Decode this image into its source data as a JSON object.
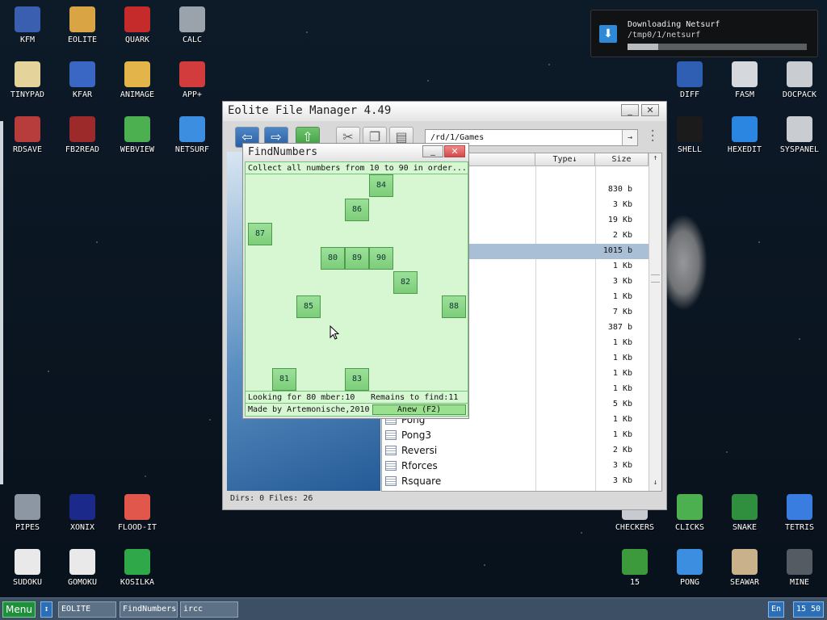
{
  "desktop_icons": [
    {
      "label": "KFM",
      "icon": "floppy-icon",
      "color": "#3b5fb0"
    },
    {
      "label": "EOLITE",
      "icon": "folder-icon",
      "color": "#d9a544"
    },
    {
      "label": "QUARK",
      "icon": "notebook-icon",
      "color": "#c62b2b"
    },
    {
      "label": "CALC",
      "icon": "calculator-icon",
      "color": "#9aa2ab"
    },
    {
      "label": "TINYPAD",
      "icon": "notepad-icon",
      "color": "#e4d39a"
    },
    {
      "label": "KFAR",
      "icon": "archive-icon",
      "color": "#3a66c4"
    },
    {
      "label": "ANIMAGE",
      "icon": "brush-icon",
      "color": "#e3b44a"
    },
    {
      "label": "APP+",
      "icon": "cube-icon",
      "color": "#d23c3c"
    },
    {
      "label": "RDSAVE",
      "icon": "disk-save-icon",
      "color": "#b73c3c"
    },
    {
      "label": "FB2READ",
      "icon": "book-icon",
      "color": "#9c2a2a"
    },
    {
      "label": "WEBVIEW",
      "icon": "webpage-icon",
      "color": "#4caf50"
    },
    {
      "label": "NETSURF",
      "icon": "globe-icon",
      "color": "#3b8ee0"
    },
    {
      "label": "DIFF",
      "icon": "compare-icon",
      "color": "#2e5fb3"
    },
    {
      "label": "FASM",
      "icon": "chip-icon",
      "color": "#d5d8dc"
    },
    {
      "label": "DOCPACK",
      "icon": "cabinet-icon",
      "color": "#c9cdd2"
    },
    {
      "label": "SHELL",
      "icon": "terminal-icon",
      "color": "#1b1b1b"
    },
    {
      "label": "HEXEDIT",
      "icon": "hex-icon",
      "color": "#2a86e0"
    },
    {
      "label": "SYSPANEL",
      "icon": "sliders-icon",
      "color": "#c9cdd2"
    },
    {
      "label": "PIPES",
      "icon": "pipes-icon",
      "color": "#8d97a3"
    },
    {
      "label": "XONIX",
      "icon": "xonix-icon",
      "color": "#1b2a8a"
    },
    {
      "label": "FLOOD-IT",
      "icon": "color-grid-icon",
      "color": "#e2574c"
    },
    {
      "label": "SUDOKU",
      "icon": "sudoku-icon",
      "color": "#e9e9e9"
    },
    {
      "label": "GOMOKU",
      "icon": "tictactoe-icon",
      "color": "#e9e9e9"
    },
    {
      "label": "KOSILKA",
      "icon": "lawnmower-icon",
      "color": "#2fa84a"
    },
    {
      "label": "CHECKERS",
      "icon": "checkers-icon",
      "color": "#c7cbd0"
    },
    {
      "label": "CLICKS",
      "icon": "blocks-icon",
      "color": "#4caf50"
    },
    {
      "label": "SNAKE",
      "icon": "snake-icon",
      "color": "#2f8f3f"
    },
    {
      "label": "TETRIS",
      "icon": "tetris-icon",
      "color": "#3a7de0"
    },
    {
      "label": "15",
      "icon": "fifteen-puzzle-icon",
      "color": "#3c9a3c"
    },
    {
      "label": "PONG",
      "icon": "pong-icon",
      "color": "#3b8ee0"
    },
    {
      "label": "SEAWAR",
      "icon": "ship-icon",
      "color": "#c9b18b"
    },
    {
      "label": "MINE",
      "icon": "mine-icon",
      "color": "#555b62"
    }
  ],
  "notification": {
    "title": "Downloading Netsurf",
    "path": "/tmp0/1/netsurf",
    "progress": 0.17
  },
  "eolite": {
    "title": "Eolite File Manager 4.49",
    "path": "/rd/1/Games",
    "columns": {
      "type": "Type↓",
      "size": "Size"
    },
    "rows": [
      {
        "name": "",
        "size": "830 b"
      },
      {
        "name": "",
        "size": "3 Kb"
      },
      {
        "name": "",
        "size": "19 Kb"
      },
      {
        "name": "",
        "size": "2 Kb"
      },
      {
        "name": "",
        "size": "1015 b",
        "selected": true
      },
      {
        "name": "",
        "size": "1 Kb"
      },
      {
        "name": "",
        "size": "3 Kb"
      },
      {
        "name": "",
        "size": "1 Kb"
      },
      {
        "name": "",
        "size": "7 Kb"
      },
      {
        "name": "",
        "size": "387 b"
      },
      {
        "name": "",
        "size": "1 Kb"
      },
      {
        "name": "",
        "size": "1 Kb"
      },
      {
        "name": "",
        "size": "1 Kb"
      },
      {
        "name": "",
        "size": "1 Kb"
      },
      {
        "name": "",
        "size": "5 Kb"
      },
      {
        "name": "Pong",
        "size": "1 Kb"
      },
      {
        "name": "Pong3",
        "size": "1 Kb"
      },
      {
        "name": "Reversi",
        "size": "2 Kb"
      },
      {
        "name": "Rforces",
        "size": "3 Kb"
      },
      {
        "name": "Rsquare",
        "size": "3 Kb"
      }
    ],
    "status": "Dirs: 0  Files: 26"
  },
  "findnumbers": {
    "title": "FindNumbers",
    "instructions": "Collect all numbers from 10 to 90 in order...",
    "tiles": [
      "84",
      "86",
      "87",
      "80",
      "89",
      "90",
      "82",
      "85",
      "88",
      "81",
      "83"
    ],
    "looking_for": "Looking for 80 mber:10",
    "remains": "Remains to find:11",
    "credits": "Made by Artemonische,2010",
    "anew_label": "Anew (F2)"
  },
  "taskbar": {
    "menu_label": "Menu",
    "tasks": [
      "EOLITE",
      "FindNumbers",
      "ircc"
    ],
    "lang": "En",
    "clock": "15 50"
  }
}
